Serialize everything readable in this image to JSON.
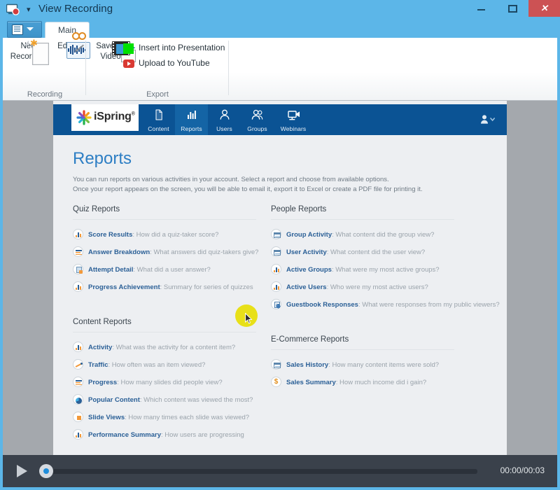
{
  "window": {
    "title": "View Recording",
    "app_icon": "screen-record-icon",
    "qat_caret": "▾",
    "controls": {
      "minimize": "–",
      "maximize": "□",
      "close": "✕"
    }
  },
  "ribbon": {
    "office_button": "file-menu-button",
    "tabs": [
      {
        "label": "Main",
        "active": true
      }
    ],
    "groups": [
      {
        "name": "Recording",
        "label": "Recording",
        "buttons": [
          {
            "label_line1": "New",
            "label_line2": "Recording",
            "icon": "new-recording-icon"
          },
          {
            "label_line1": "Edit",
            "label_line2": "",
            "icon": "edit-audio-icon"
          }
        ]
      },
      {
        "name": "Export",
        "label": "Export",
        "buttons": [
          {
            "label_line1": "Save as",
            "label_line2": "Video",
            "icon": "save-as-video-icon"
          }
        ],
        "small_buttons": [
          {
            "label": "Insert into Presentation",
            "icon": "green-square-icon"
          },
          {
            "label": "Upload to YouTube",
            "icon": "youtube-icon"
          }
        ]
      }
    ]
  },
  "site": {
    "logo_text": "iSpring",
    "logo_trademark": "®",
    "nav": [
      {
        "label": "Content",
        "icon": "document-icon",
        "active": false
      },
      {
        "label": "Reports",
        "icon": "bar-chart-icon",
        "active": true
      },
      {
        "label": "Users",
        "icon": "user-icon",
        "active": false
      },
      {
        "label": "Groups",
        "icon": "group-icon",
        "active": false
      },
      {
        "label": "Webinars",
        "icon": "webcam-icon",
        "active": false
      }
    ],
    "account_menu": "user-account-menu",
    "page": {
      "title": "Reports",
      "intro_line1": "You can run reports on various activities in your account. Select a report and choose from available options.",
      "intro_line2": "Once your report appears on the screen, you will be able to email it, export it to Excel or create a PDF file for printing it."
    },
    "sections": [
      {
        "id": "quiz-reports",
        "title": "Quiz Reports",
        "column": "left",
        "items": [
          {
            "name": "Score Results",
            "desc": ": How did a quiz-taker score?",
            "icon": "bar-chart-report-icon"
          },
          {
            "name": "Answer Breakdown",
            "desc": ": What answers did quiz-takers give?",
            "icon": "list-report-icon"
          },
          {
            "name": "Attempt Detail",
            "desc": ": What did a user answer?",
            "icon": "document-report-icon"
          },
          {
            "name": "Progress Achievement",
            "desc": ": Summary for series of quizzes",
            "icon": "bar-chart-report-icon"
          }
        ]
      },
      {
        "id": "content-reports",
        "title": "Content Reports",
        "column": "left",
        "items": [
          {
            "name": "Activity",
            "desc": ": What was the activity for a content item?",
            "icon": "bar-chart-report-icon"
          },
          {
            "name": "Traffic",
            "desc": ": How often was an item viewed?",
            "icon": "line-chart-report-icon"
          },
          {
            "name": "Progress",
            "desc": ": How many slides did people view?",
            "icon": "list-report-icon"
          },
          {
            "name": "Popular Content",
            "desc": ": Which content was viewed the most?",
            "icon": "pie-chart-report-icon"
          },
          {
            "name": "Slide Views",
            "desc": ": How many times each slide was viewed?",
            "icon": "square-report-icon"
          },
          {
            "name": "Performance Summary",
            "desc": ": How users are progressing",
            "icon": "bar-chart-report-icon"
          }
        ]
      },
      {
        "id": "people-reports",
        "title": "People Reports",
        "column": "right",
        "items": [
          {
            "name": "Group Activity",
            "desc": ": What content did the group view?",
            "icon": "window-report-icon"
          },
          {
            "name": "User Activity",
            "desc": ": What content did the user view?",
            "icon": "window-report-icon"
          },
          {
            "name": "Active Groups",
            "desc": ": What were my most active groups?",
            "icon": "bar-chart-report-icon"
          },
          {
            "name": "Active Users",
            "desc": ": Who were my most active users?",
            "icon": "bar-chart-report-icon"
          },
          {
            "name": "Guestbook Responses",
            "desc": ": What were responses from my public viewers?",
            "icon": "note-report-icon"
          }
        ]
      },
      {
        "id": "ecommerce-reports",
        "title": "E-Commerce Reports",
        "column": "right",
        "items": [
          {
            "name": "Sales History",
            "desc": ": How many content items were sold?",
            "icon": "window-report-icon"
          },
          {
            "name": "Sales Summary",
            "desc": ": How much income did i gain?",
            "icon": "dollar-report-icon"
          }
        ]
      }
    ]
  },
  "player": {
    "play_label": "play-button",
    "current_time": "00:00",
    "total_time": "00:03",
    "time_display": "00:00/00:03",
    "progress_percent": 0
  },
  "colors": {
    "accent_blue": "#5cb6e8",
    "nav_blue": "#0b5394",
    "nav_active": "#1464a5",
    "link_blue": "#2a5f96",
    "title_blue": "#2d7ec4",
    "close_red": "#cc5254",
    "player_bg": "#3a414b",
    "cursor_highlight": "#e8e019"
  }
}
